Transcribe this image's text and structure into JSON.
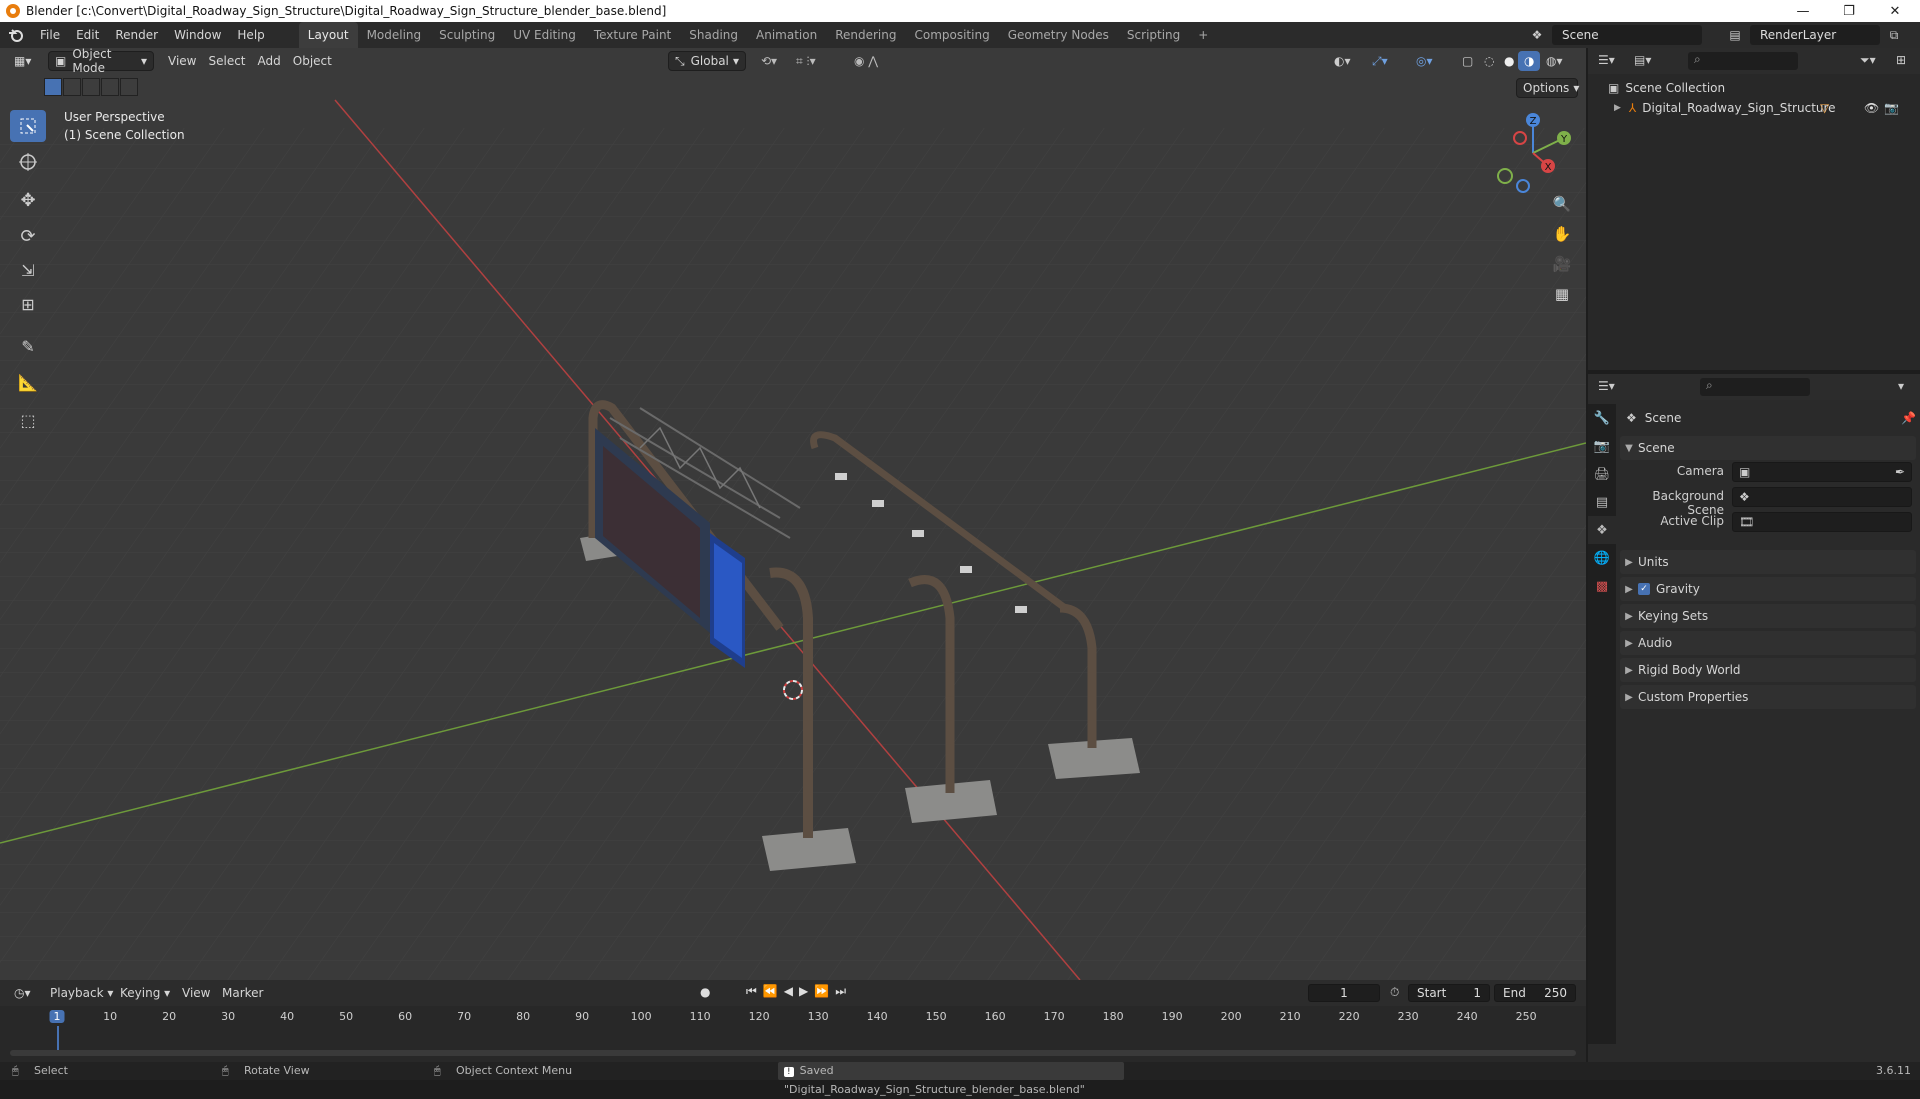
{
  "window": {
    "title": "Blender [c:\\Convert\\Digital_Roadway_Sign_Structure\\Digital_Roadway_Sign_Structure_blender_base.blend]",
    "controls": [
      "—",
      "❐",
      "✕"
    ]
  },
  "menus": [
    "File",
    "Edit",
    "Render",
    "Window",
    "Help"
  ],
  "workspaces": [
    "Layout",
    "Modeling",
    "Sculpting",
    "UV Editing",
    "Texture Paint",
    "Shading",
    "Animation",
    "Rendering",
    "Compositing",
    "Geometry Nodes",
    "Scripting",
    "+"
  ],
  "active_workspace": "Layout",
  "top_right": {
    "scene_label": "Scene",
    "view_layer_label": "RenderLayer"
  },
  "viewport": {
    "mode": "Object Mode",
    "header_menus": [
      "View",
      "Select",
      "Add",
      "Object"
    ],
    "transform_orientation": "Global",
    "options_label": "Options",
    "overlay_title": "User Perspective",
    "overlay_collection": "(1) Scene Collection",
    "gizmo_axes": {
      "x": "X",
      "y": "Y",
      "z": "Z"
    }
  },
  "outliner": {
    "root": "Scene Collection",
    "items": [
      {
        "label": "Digital_Roadway_Sign_Structure"
      }
    ]
  },
  "properties": {
    "context": "Scene",
    "panel_title": "Scene",
    "fields": [
      {
        "label": "Camera",
        "value": ""
      },
      {
        "label": "Background Scene",
        "value": ""
      },
      {
        "label": "Active Clip",
        "value": ""
      }
    ],
    "sections": [
      "Units",
      "Gravity",
      "Keying Sets",
      "Audio",
      "Rigid Body World",
      "Custom Properties"
    ],
    "gravity_enabled": true
  },
  "timeline": {
    "menus": [
      "Playback",
      "Keying",
      "View",
      "Marker"
    ],
    "current_frame": "1",
    "start_label": "Start",
    "start_value": "1",
    "end_label": "End",
    "end_value": "250",
    "ticks": [
      "1",
      "10",
      "20",
      "30",
      "40",
      "50",
      "60",
      "70",
      "80",
      "90",
      "100",
      "110",
      "120",
      "130",
      "140",
      "150",
      "160",
      "170",
      "180",
      "190",
      "200",
      "210",
      "220",
      "230",
      "240",
      "250"
    ]
  },
  "statusbar": {
    "select": "Select",
    "rotate": "Rotate View",
    "context_menu": "Object Context Menu",
    "message": "Saved \"Digital_Roadway_Sign_Structure_blender_base.blend\"",
    "version": "3.6.11"
  },
  "colors": {
    "accent": "#4772b3",
    "x_axis": "#d64545",
    "y_axis": "#7fb04a",
    "z_axis": "#4a86d9",
    "selection_orange": "#e87d0d"
  }
}
